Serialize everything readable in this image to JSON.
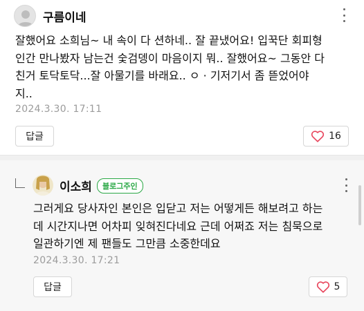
{
  "comments": [
    {
      "author": "구름이네",
      "avatar_icon": "default-user-avatar",
      "text": "잘했어요 소희님~ 내 속이 다 션하네.. 잘 끝냈어요! 입꾹단 회피형\n인간 만나봤자 남는건 숯검뎅이 마음이지 뭐.. 잘했어요~ 그동안 다\n친거 토닥토닥...잘 아물기를 바래요.. ㅇ · 기저기서 좀 뜯었어야\n지..",
      "date": "2024.3.30.  17:11",
      "reply_label": "답글",
      "like_count": "16"
    },
    {
      "author": "이소희",
      "badge": "블로그주인",
      "avatar_icon": "profile-photo-avatar",
      "text": "그러게요 당사자인 본인은 입닫고 저는 어떻게든 해보려고 하는\n데 시간지나면 어차피 잊혀진다네요 근데 어쩌죠 저는 침묵으로\n일관하기엔 제 팬들도 그만큼 소중한데요",
      "date": "2024.3.30.  17:21",
      "reply_label": "답글",
      "like_count": "5"
    }
  ],
  "colors": {
    "heart": "#e8455c",
    "badge_green": "#2aa845",
    "reply_background": "#f7f7f7",
    "date_gray": "#9b9b9b"
  }
}
